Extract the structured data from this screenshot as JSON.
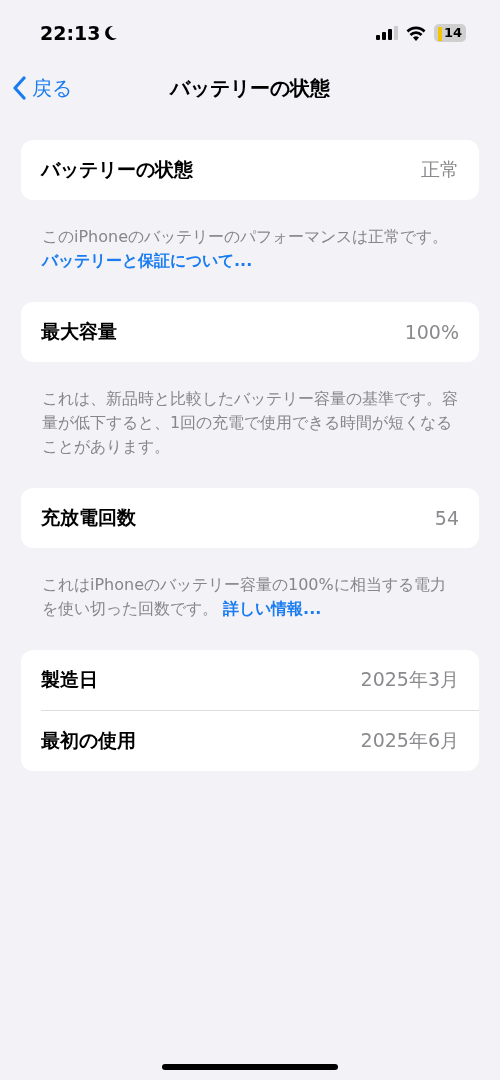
{
  "status_bar": {
    "time": "22:13",
    "battery": "14"
  },
  "nav": {
    "back": "戻る",
    "title": "バッテリーの状態"
  },
  "sections": [
    {
      "rows": [
        {
          "label": "バッテリーの状態",
          "value": "正常"
        }
      ],
      "footer": {
        "text": "このiPhoneのバッテリーのパフォーマンスは正常です。",
        "link": "バッテリーと保証について..."
      }
    },
    {
      "rows": [
        {
          "label": "最大容量",
          "value": "100%"
        }
      ],
      "footer": {
        "text": "これは、新品時と比較したバッテリー容量の基準です。容量が低下すると、1回の充電で使用できる時間が短くなることがあります。"
      }
    },
    {
      "rows": [
        {
          "label": "充放電回数",
          "value": "54"
        }
      ],
      "footer": {
        "text": "これはiPhoneのバッテリー容量の100%に相当する電力を使い切った回数です。",
        "link": "詳しい情報..."
      }
    },
    {
      "rows": [
        {
          "label": "製造日",
          "value": "2025年3月"
        },
        {
          "label": "最初の使用",
          "value": "2025年6月"
        }
      ]
    }
  ]
}
